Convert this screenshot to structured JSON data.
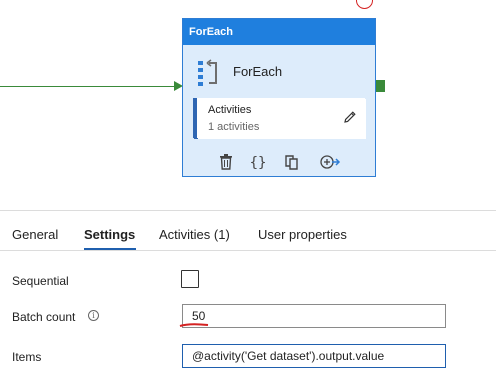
{
  "pipeline_canvas": {
    "node": {
      "header_title": "ForEach",
      "name": "ForEach",
      "activities_title": "Activities",
      "activities_count": "1 activities",
      "toolbar_icons": [
        "trash-icon",
        "code-braces-icon",
        "copy-icon",
        "add-output-icon"
      ]
    },
    "colors": {
      "header": "#1f7fde",
      "node_body": "#ddecfb",
      "connector": "#3a8a3a",
      "accent": "#1f5fae",
      "annotation": "#d42222"
    }
  },
  "tabs": [
    {
      "label": "General",
      "active": false
    },
    {
      "label": "Settings",
      "active": true
    },
    {
      "label": "Activities (1)",
      "active": false
    },
    {
      "label": "User properties",
      "active": false
    }
  ],
  "settings": {
    "sequential_label": "Sequential",
    "sequential_checked": false,
    "batch_count_label": "Batch count",
    "batch_count_value": "50",
    "items_label": "Items",
    "items_value": "@activity('Get dataset').output.value"
  }
}
